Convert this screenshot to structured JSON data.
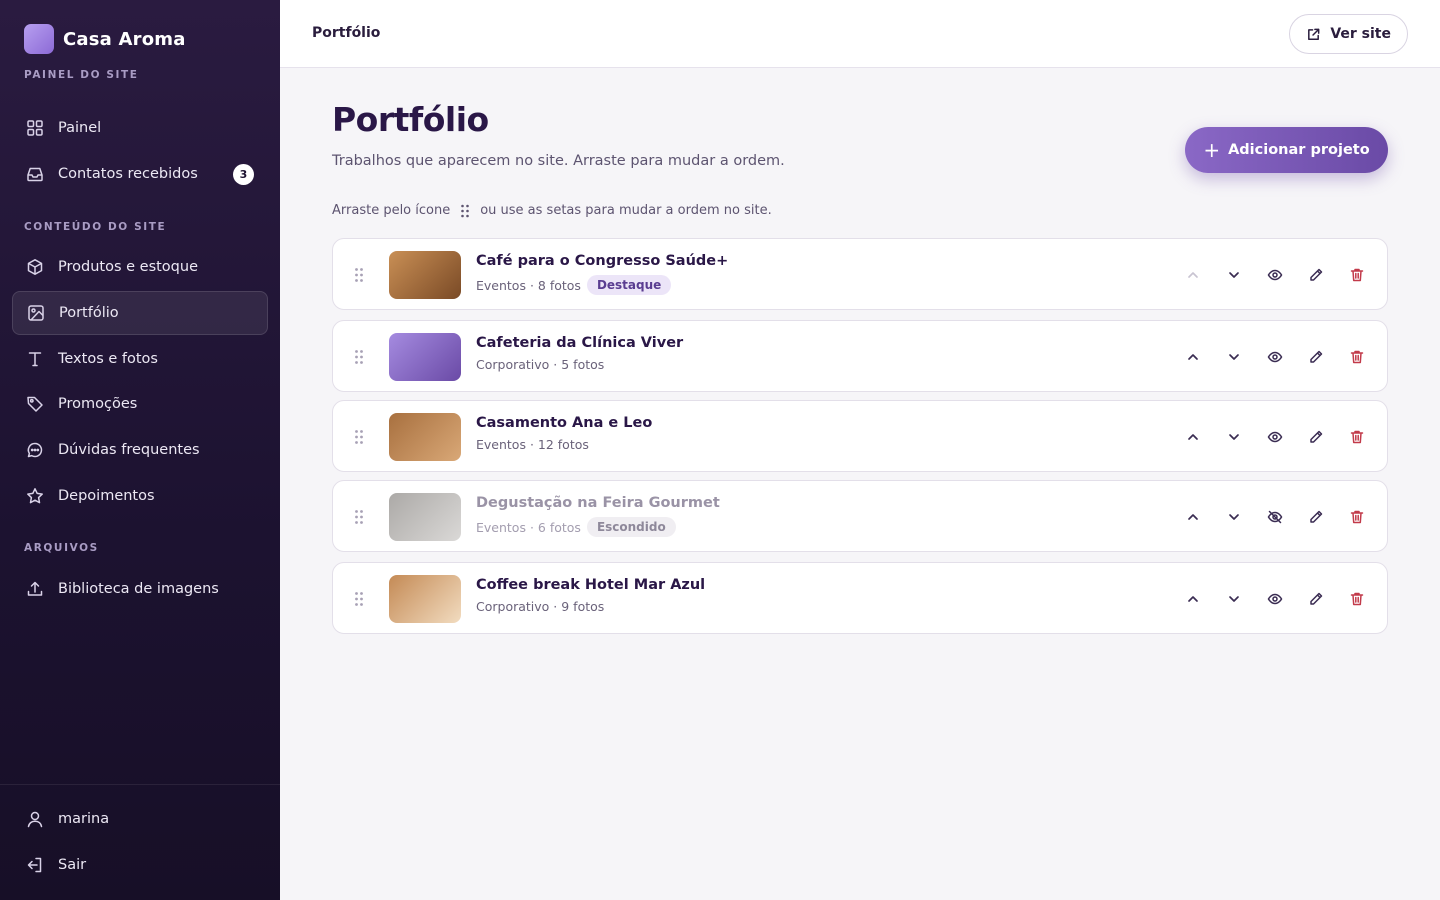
{
  "sidebar": {
    "brand": "Casa Aroma",
    "subtitle": "PAINEL DO SITE",
    "main_items": [
      {
        "label": "Painel",
        "icon": "grid-icon"
      },
      {
        "label": "Contatos recebidos",
        "icon": "inbox-icon",
        "badge": "3"
      }
    ],
    "content_section": "CONTEÚDO DO SITE",
    "content_items": [
      {
        "label": "Produtos e estoque",
        "icon": "box-icon"
      },
      {
        "label": "Portfólio",
        "icon": "image-icon",
        "active": true
      },
      {
        "label": "Textos e fotos",
        "icon": "text-icon"
      },
      {
        "label": "Promoções",
        "icon": "tag-icon"
      },
      {
        "label": "Dúvidas frequentes",
        "icon": "chat-icon"
      },
      {
        "label": "Depoimentos",
        "icon": "star-icon"
      }
    ],
    "files_section": "ARQUIVOS",
    "files_items": [
      {
        "label": "Biblioteca de imagens",
        "icon": "upload-icon"
      }
    ],
    "user": "marina",
    "logout": "Sair"
  },
  "topbar": {
    "title": "Portfólio",
    "view_site": "Ver site"
  },
  "main": {
    "title": "Portfólio",
    "subtitle": "Trabalhos que aparecem no site. Arraste para mudar a ordem.",
    "add_button": "Adicionar projeto",
    "hint_before": "Arraste pelo ícone",
    "hint_after": "ou use as setas para mudar a ordem no site."
  },
  "projects": [
    {
      "title": "Café para o Congresso Saúde+",
      "meta": "Eventos · 8 fotos",
      "tag": "Destaque",
      "visible": true,
      "thumb_colors": [
        "#c98f55",
        "#7a4a26"
      ]
    },
    {
      "title": "Cafeteria da Clínica Viver",
      "meta": "Corporativo · 5 fotos",
      "tag": "",
      "visible": true,
      "thumb_colors": [
        "#a58be0",
        "#6a4aa6"
      ]
    },
    {
      "title": "Casamento Ana e Leo",
      "meta": "Eventos · 12 fotos",
      "tag": "",
      "visible": true,
      "thumb_colors": [
        "#a8703f",
        "#d9a877"
      ]
    },
    {
      "title": "Degustação na Feira Gourmet",
      "meta": "Eventos · 6 fotos",
      "tag": "Escondido",
      "visible": false,
      "thumb_colors": [
        "#9d9a97",
        "#d4d2d0"
      ]
    },
    {
      "title": "Coffee break Hotel Mar Azul",
      "meta": "Corporativo · 9 fotos",
      "tag": "",
      "visible": true,
      "thumb_colors": [
        "#c48a55",
        "#f2dcc0"
      ]
    }
  ],
  "colors": {
    "accent": "#7a58b8",
    "danger": "#c23a4a",
    "sidebar_bg": "#1c1230"
  }
}
